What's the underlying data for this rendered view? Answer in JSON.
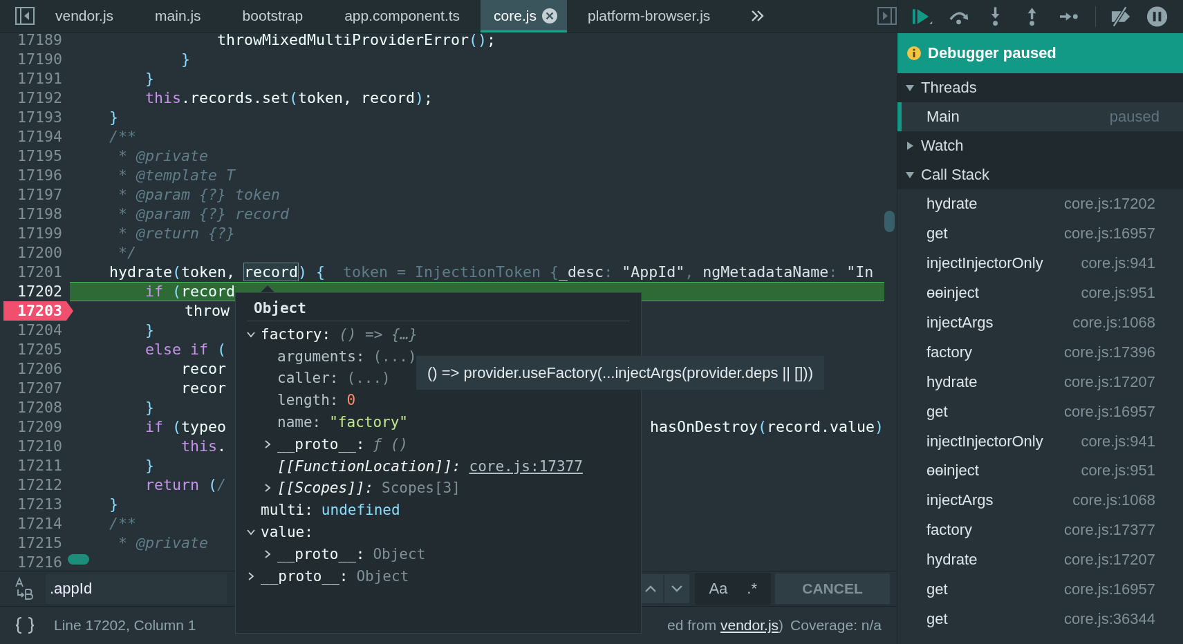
{
  "tabs": [
    {
      "label": "vendor.js",
      "selected": false
    },
    {
      "label": "main.js",
      "selected": false
    },
    {
      "label": "bootstrap",
      "selected": false
    },
    {
      "label": "app.component.ts",
      "selected": false
    },
    {
      "label": "core.js",
      "selected": true
    },
    {
      "label": "platform-browser.js",
      "selected": false
    }
  ],
  "code": [
    {
      "num": "17189",
      "current": false,
      "breakpoint": false,
      "tokens": [
        {
          "text": "                throwMixedMultiProviderError",
          "kind": "id"
        },
        {
          "text": "()",
          "kind": "pn"
        },
        {
          "text": ";",
          "kind": "id"
        }
      ]
    },
    {
      "num": "17190",
      "current": false,
      "breakpoint": false,
      "tokens": [
        {
          "text": "            }",
          "kind": "pn"
        }
      ]
    },
    {
      "num": "17191",
      "current": false,
      "breakpoint": false,
      "tokens": [
        {
          "text": "        }",
          "kind": "pn"
        }
      ]
    },
    {
      "num": "17192",
      "current": false,
      "breakpoint": false,
      "tokens": [
        {
          "text": "        this",
          "kind": "kw"
        },
        {
          "text": ".records.set",
          "kind": "id"
        },
        {
          "text": "(",
          "kind": "pn"
        },
        {
          "text": "token, record",
          "kind": "id"
        },
        {
          "text": ")",
          "kind": "pn"
        },
        {
          "text": ";",
          "kind": "id"
        }
      ]
    },
    {
      "num": "17193",
      "current": false,
      "breakpoint": false,
      "tokens": [
        {
          "text": "    }",
          "kind": "pn"
        }
      ]
    },
    {
      "num": "17194",
      "current": false,
      "breakpoint": false,
      "tokens": [
        {
          "text": "    /**",
          "kind": "cm"
        }
      ]
    },
    {
      "num": "17195",
      "current": false,
      "breakpoint": false,
      "tokens": [
        {
          "text": "     * @private",
          "kind": "cm"
        }
      ]
    },
    {
      "num": "17196",
      "current": false,
      "breakpoint": false,
      "tokens": [
        {
          "text": "     * @template T",
          "kind": "cm"
        }
      ]
    },
    {
      "num": "17197",
      "current": false,
      "breakpoint": false,
      "tokens": [
        {
          "text": "     * @param {?} token",
          "kind": "cm"
        }
      ]
    },
    {
      "num": "17198",
      "current": false,
      "breakpoint": false,
      "tokens": [
        {
          "text": "     * @param {?} record",
          "kind": "cm"
        }
      ]
    },
    {
      "num": "17199",
      "current": false,
      "breakpoint": false,
      "tokens": [
        {
          "text": "     * @return {?}",
          "kind": "cm"
        }
      ]
    },
    {
      "num": "17200",
      "current": false,
      "breakpoint": false,
      "tokens": [
        {
          "text": "     */",
          "kind": "cm"
        }
      ]
    },
    {
      "num": "17201",
      "current": false,
      "breakpoint": false,
      "tokens": [
        {
          "text": "    hydrate",
          "kind": "id"
        },
        {
          "text": "(",
          "kind": "pn"
        },
        {
          "text": "token, ",
          "kind": "id"
        },
        {
          "text": "record",
          "kind": "hv"
        },
        {
          "text": ")",
          "kind": "pn"
        },
        {
          "text": " {",
          "kind": "pn"
        }
      ],
      "inline": [
        {
          "text": "token = InjectionToken {",
          "kind": "dim"
        },
        {
          "text": "_desc",
          "kind": "bright"
        },
        {
          "text": ": ",
          "kind": "dim"
        },
        {
          "text": "\"AppId\"",
          "kind": "bright"
        },
        {
          "text": ", ",
          "kind": "dim"
        },
        {
          "text": "ngMetadataName",
          "kind": "bright"
        },
        {
          "text": ": ",
          "kind": "dim"
        },
        {
          "text": "\"In",
          "kind": "bright"
        }
      ]
    },
    {
      "num": "17202",
      "current": true,
      "breakpoint": false,
      "tokens": [
        {
          "text": "        if",
          "kind": "kw"
        },
        {
          "text": " (",
          "kind": "pn"
        },
        {
          "text": "record",
          "kind": "id"
        }
      ]
    },
    {
      "num": "17203",
      "current": false,
      "breakpoint": true,
      "tokens": [
        {
          "text": "            throw",
          "kind": "id"
        }
      ]
    },
    {
      "num": "17204",
      "current": false,
      "breakpoint": false,
      "tokens": [
        {
          "text": "        }",
          "kind": "pn"
        }
      ]
    },
    {
      "num": "17205",
      "current": false,
      "breakpoint": false,
      "tokens": [
        {
          "text": "        else if",
          "kind": "kw"
        },
        {
          "text": " (",
          "kind": "pn"
        }
      ]
    },
    {
      "num": "17206",
      "current": false,
      "breakpoint": false,
      "tokens": [
        {
          "text": "            recor",
          "kind": "id"
        }
      ]
    },
    {
      "num": "17207",
      "current": false,
      "breakpoint": false,
      "tokens": [
        {
          "text": "            recor",
          "kind": "id"
        }
      ]
    },
    {
      "num": "17208",
      "current": false,
      "breakpoint": false,
      "tokens": [
        {
          "text": "        }",
          "kind": "pn"
        }
      ]
    },
    {
      "num": "17209",
      "current": false,
      "breakpoint": false,
      "tokens": [
        {
          "text": "        if",
          "kind": "kw"
        },
        {
          "text": " (",
          "kind": "pn"
        },
        {
          "text": "typeo",
          "kind": "id"
        }
      ],
      "right": [
        {
          "text": "hasOnDestroy",
          "kind": "id"
        },
        {
          "text": "(",
          "kind": "pn"
        },
        {
          "text": "record.value",
          "kind": "id"
        },
        {
          "text": ")",
          "kind": "pn"
        }
      ]
    },
    {
      "num": "17210",
      "current": false,
      "breakpoint": false,
      "tokens": [
        {
          "text": "            this",
          "kind": "kw"
        },
        {
          "text": ".",
          "kind": "id"
        }
      ]
    },
    {
      "num": "17211",
      "current": false,
      "breakpoint": false,
      "tokens": [
        {
          "text": "        }",
          "kind": "pn"
        }
      ]
    },
    {
      "num": "17212",
      "current": false,
      "breakpoint": false,
      "tokens": [
        {
          "text": "        return",
          "kind": "kw"
        },
        {
          "text": " (",
          "kind": "pn"
        },
        {
          "text": "/",
          "kind": "cm"
        }
      ]
    },
    {
      "num": "17213",
      "current": false,
      "breakpoint": false,
      "tokens": [
        {
          "text": "    }",
          "kind": "pn"
        }
      ]
    },
    {
      "num": "17214",
      "current": false,
      "breakpoint": false,
      "tokens": [
        {
          "text": "    /**",
          "kind": "cm"
        }
      ]
    },
    {
      "num": "17215",
      "current": false,
      "breakpoint": false,
      "tokens": [
        {
          "text": "     * @private",
          "kind": "cm"
        }
      ]
    },
    {
      "num": "17216",
      "current": false,
      "breakpoint": false
    }
  ],
  "popover": {
    "title": "Object",
    "properties": [
      {
        "key": "factory:",
        "kind": "own",
        "value": {
          "text": "() => {…}",
          "kind": "sig"
        },
        "expanded": true,
        "children": [
          {
            "key": "arguments:",
            "kind": "dim",
            "value": {
              "text": "(...)",
              "kind": "dim"
            }
          },
          {
            "key": "caller:",
            "kind": "dim",
            "value": {
              "text": "(...)",
              "kind": "dim"
            }
          },
          {
            "key": "length:",
            "kind": "dim",
            "value": {
              "text": "0",
              "kind": "num"
            }
          },
          {
            "key": "name:",
            "kind": "dim",
            "value": {
              "text": "\"factory\"",
              "kind": "str"
            }
          },
          {
            "key": "__proto__:",
            "kind": "own",
            "value": {
              "text": "ƒ ()",
              "kind": "sig"
            },
            "expanded": false
          },
          {
            "key": "[[FunctionLocation]]:",
            "kind": "internal",
            "value": {
              "text": "core.js:17377",
              "kind": "link"
            }
          },
          {
            "key": "[[Scopes]]:",
            "kind": "internal",
            "value": {
              "text": "Scopes[3]",
              "kind": "obj"
            },
            "expanded": false
          }
        ]
      },
      {
        "key": "multi:",
        "kind": "own",
        "value": {
          "text": "undefined",
          "kind": "undef"
        }
      },
      {
        "key": "value:",
        "kind": "own",
        "expanded": true,
        "children": [
          {
            "key": "__proto__:",
            "kind": "own",
            "value": {
              "text": "Object",
              "kind": "obj"
            },
            "expanded": false
          }
        ]
      },
      {
        "key": "__proto__:",
        "kind": "own",
        "value": {
          "text": "Object",
          "kind": "obj"
        },
        "expanded": false
      }
    ]
  },
  "tooltip": "() => provider.useFactory(...injectArgs(provider.deps || []))",
  "search": {
    "value": ".appId",
    "buttons": [
      "Aa",
      ".*"
    ],
    "cancel": "CANCEL"
  },
  "status": {
    "position": "Line 17202, Column 1",
    "source_prefix": "ed from ",
    "source_link": "vendor.js",
    "source_suffix": ")",
    "coverage": "Coverage: n/a"
  },
  "sidebar": {
    "banner": "Debugger paused",
    "sections": [
      {
        "kind": "threads",
        "title": "Threads",
        "expanded": true,
        "threads": [
          {
            "name": "Main",
            "status": "paused",
            "selected": true
          }
        ]
      },
      {
        "kind": "watch",
        "title": "Watch",
        "expanded": false
      },
      {
        "kind": "callstack",
        "title": "Call Stack",
        "expanded": true,
        "frames": [
          {
            "name": "hydrate",
            "location": "core.js:17202"
          },
          {
            "name": "get",
            "location": "core.js:16957"
          },
          {
            "name": "injectInjectorOnly",
            "location": "core.js:941"
          },
          {
            "name": "ɵɵinject",
            "location": "core.js:951"
          },
          {
            "name": "injectArgs",
            "location": "core.js:1068"
          },
          {
            "name": "factory",
            "location": "core.js:17396"
          },
          {
            "name": "hydrate",
            "location": "core.js:17207"
          },
          {
            "name": "get",
            "location": "core.js:16957"
          },
          {
            "name": "injectInjectorOnly",
            "location": "core.js:941"
          },
          {
            "name": "ɵɵinject",
            "location": "core.js:951"
          },
          {
            "name": "injectArgs",
            "location": "core.js:1068"
          },
          {
            "name": "factory",
            "location": "core.js:17377"
          },
          {
            "name": "hydrate",
            "location": "core.js:17207"
          },
          {
            "name": "get",
            "location": "core.js:16957"
          },
          {
            "name": "get",
            "location": "core.js:36344"
          }
        ]
      }
    ]
  }
}
